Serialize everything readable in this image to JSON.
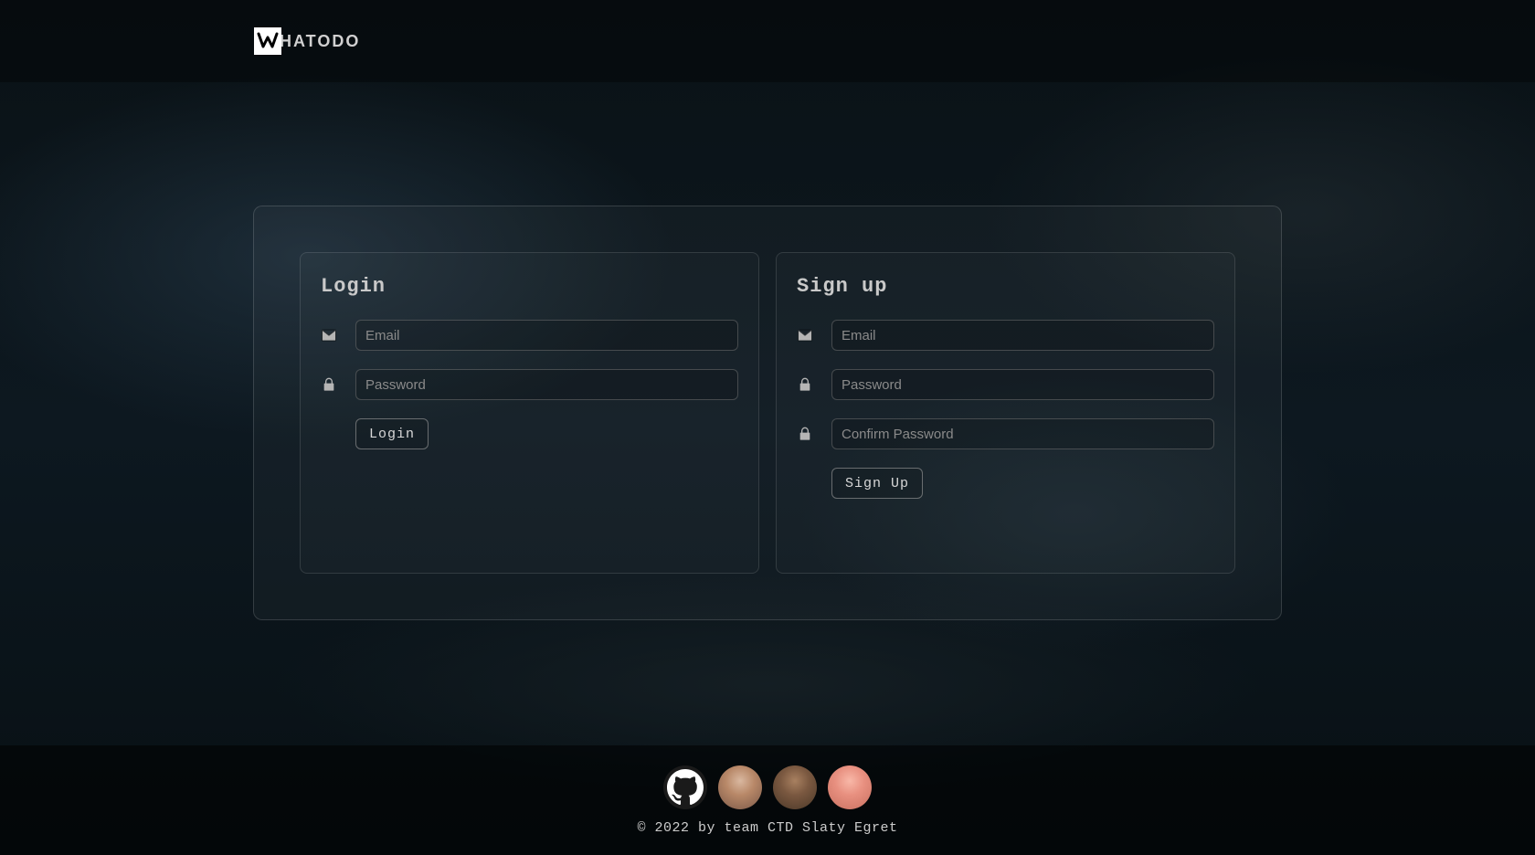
{
  "brand": {
    "name": "WHATODO",
    "display": "HATODO"
  },
  "login": {
    "title": "Login",
    "email_placeholder": "Email",
    "password_placeholder": "Password",
    "button_label": "Login"
  },
  "signup": {
    "title": "Sign up",
    "email_placeholder": "Email",
    "password_placeholder": "Password",
    "confirm_placeholder": "Confirm Password",
    "button_label": "Sign Up"
  },
  "footer": {
    "copyright": "© 2022 by team CTD Slaty Egret"
  }
}
